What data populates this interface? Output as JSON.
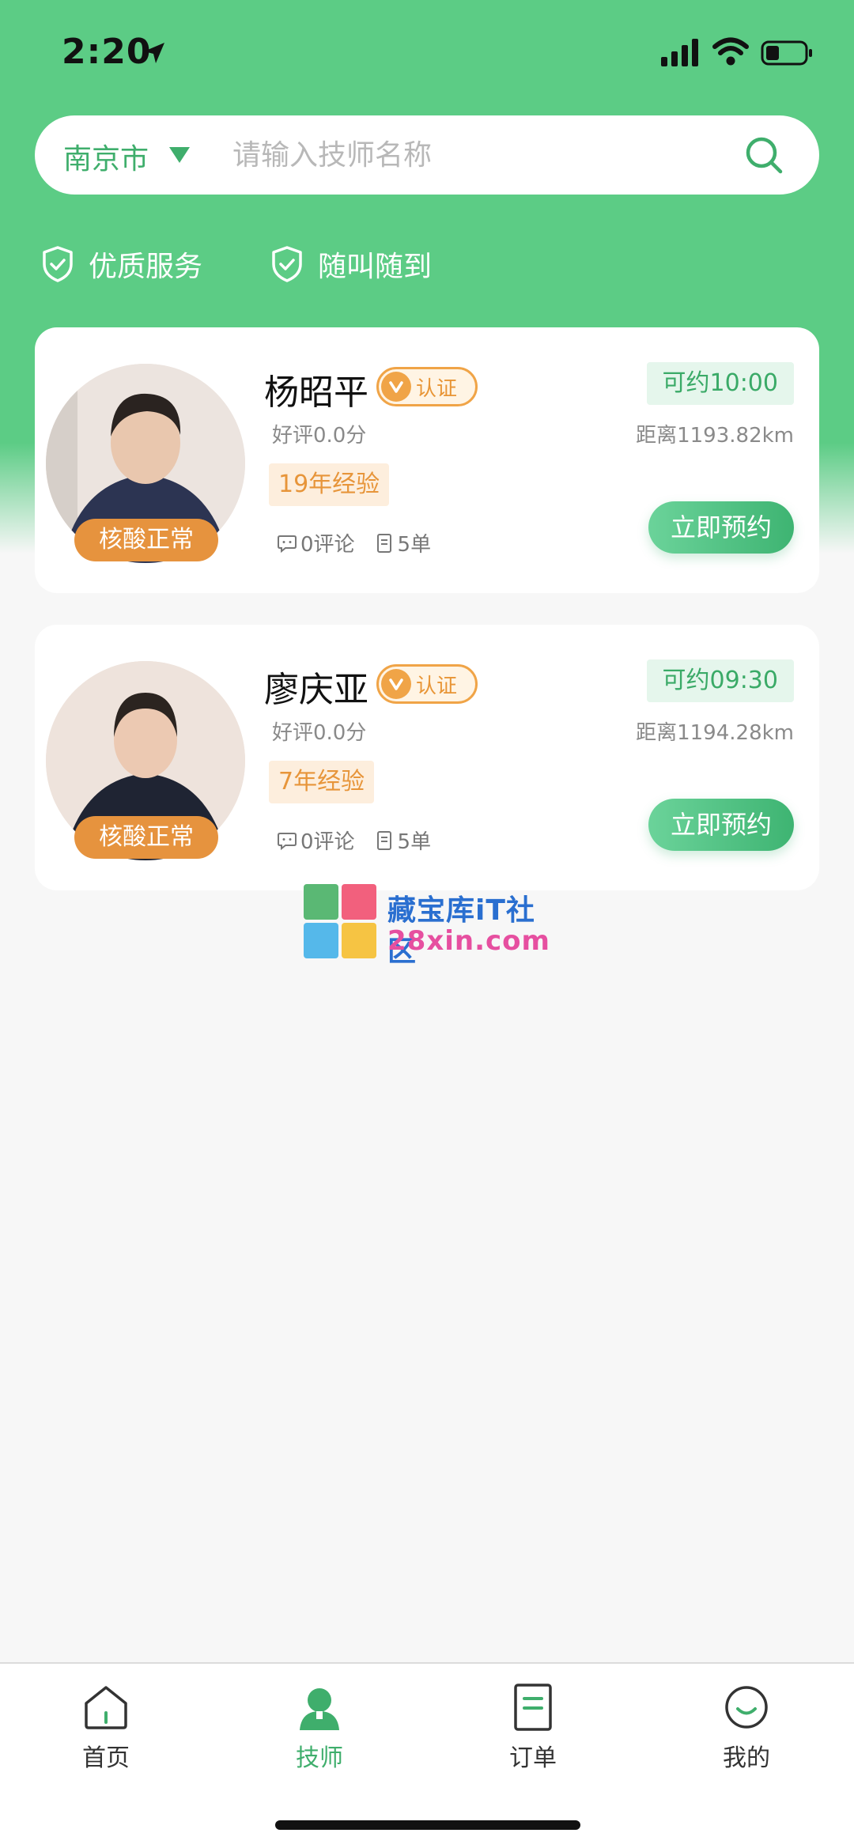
{
  "status_bar": {
    "time": "2:20"
  },
  "search": {
    "city": "南京市",
    "placeholder": "请输入技师名称"
  },
  "features": [
    "优质服务",
    "随叫随到"
  ],
  "technicians": [
    {
      "name": "杨昭平",
      "cert_label": "认证",
      "rating": "好评0.0分",
      "experience": "19年经验",
      "health_badge": "核酸正常",
      "comments": "0评论",
      "orders": "5单",
      "available": "可约10:00",
      "distance": "距离1193.82km",
      "book_label": "立即预约"
    },
    {
      "name": "廖庆亚",
      "cert_label": "认证",
      "rating": "好评0.0分",
      "experience": "7年经验",
      "health_badge": "核酸正常",
      "comments": "0评论",
      "orders": "5单",
      "available": "可约09:30",
      "distance": "距离1194.28km",
      "book_label": "立即预约"
    }
  ],
  "watermark": {
    "line1": "藏宝库iT社区",
    "line2": "28xin.com"
  },
  "tabs": [
    {
      "label": "首页",
      "icon": "home-icon",
      "active": false
    },
    {
      "label": "技师",
      "icon": "technician-icon",
      "active": true
    },
    {
      "label": "订单",
      "icon": "order-icon",
      "active": false
    },
    {
      "label": "我的",
      "icon": "profile-icon",
      "active": false
    }
  ],
  "colors": {
    "primary": "#5ccc85",
    "accent_green": "#3fae6c",
    "orange": "#e6933e",
    "background": "#f7f7f7"
  }
}
